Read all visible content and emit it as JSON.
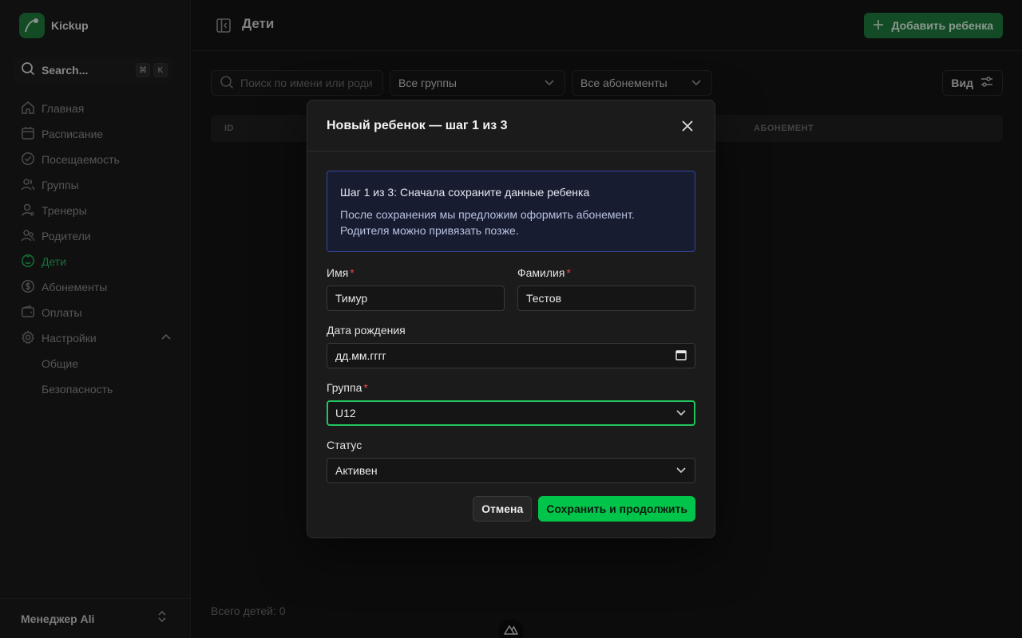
{
  "app": {
    "name": "Kickup",
    "logo_icon": "leaf-logo-icon"
  },
  "sidebar": {
    "search_label": "Search...",
    "shortcut": [
      "⌘",
      "K"
    ],
    "items": [
      {
        "label": "Главная",
        "icon": "home-icon"
      },
      {
        "label": "Расписание",
        "icon": "calendar-icon"
      },
      {
        "label": "Посещаемость",
        "icon": "check-circle-icon"
      },
      {
        "label": "Группы",
        "icon": "users-icon"
      },
      {
        "label": "Тренеры",
        "icon": "user-icon"
      },
      {
        "label": "Родители",
        "icon": "parents-icon"
      },
      {
        "label": "Дети",
        "icon": "child-icon",
        "active": true
      },
      {
        "label": "Абонементы",
        "icon": "dollar-icon"
      },
      {
        "label": "Оплаты",
        "icon": "wallet-icon"
      },
      {
        "label": "Настройки",
        "icon": "gear-icon",
        "expanded": true
      }
    ],
    "sub_items": [
      "Общие",
      "Безопасность"
    ],
    "user_name": "Менеджер Ali"
  },
  "header": {
    "title": "Дети",
    "add_button": "Добавить ребенка"
  },
  "filters": {
    "search_placeholder": "Поиск по имени или роди",
    "group_select": "Все группы",
    "subscription_select": "Все абонементы",
    "view_button": "Вид"
  },
  "table": {
    "columns": [
      "ID",
      "АБОНЕМЕНТ"
    ]
  },
  "footer": {
    "total": "Всего детей: 0"
  },
  "modal": {
    "title": "Новый ребенок — шаг 1 из 3",
    "info_title": "Шаг 1 из 3: Сначала сохраните данные ребенка",
    "info_text_1": "После сохранения мы предложим оформить абонемент.",
    "info_text_2": "Родителя можно привязать позже.",
    "first_name_label": "Имя",
    "first_name_value": "Тимур",
    "last_name_label": "Фамилия",
    "last_name_value": "Тестов",
    "birthdate_label": "Дата рождения",
    "birthdate_placeholder": "дд.мм.гггг",
    "group_label": "Группа",
    "group_value": "U12",
    "status_label": "Статус",
    "status_value": "Активен",
    "required_mark": "*",
    "cancel_button": "Отмена",
    "save_button": "Сохранить и продолжить"
  },
  "colors": {
    "accent": "#22c55e",
    "info_border": "#3346a0",
    "required": "#e5484d"
  }
}
